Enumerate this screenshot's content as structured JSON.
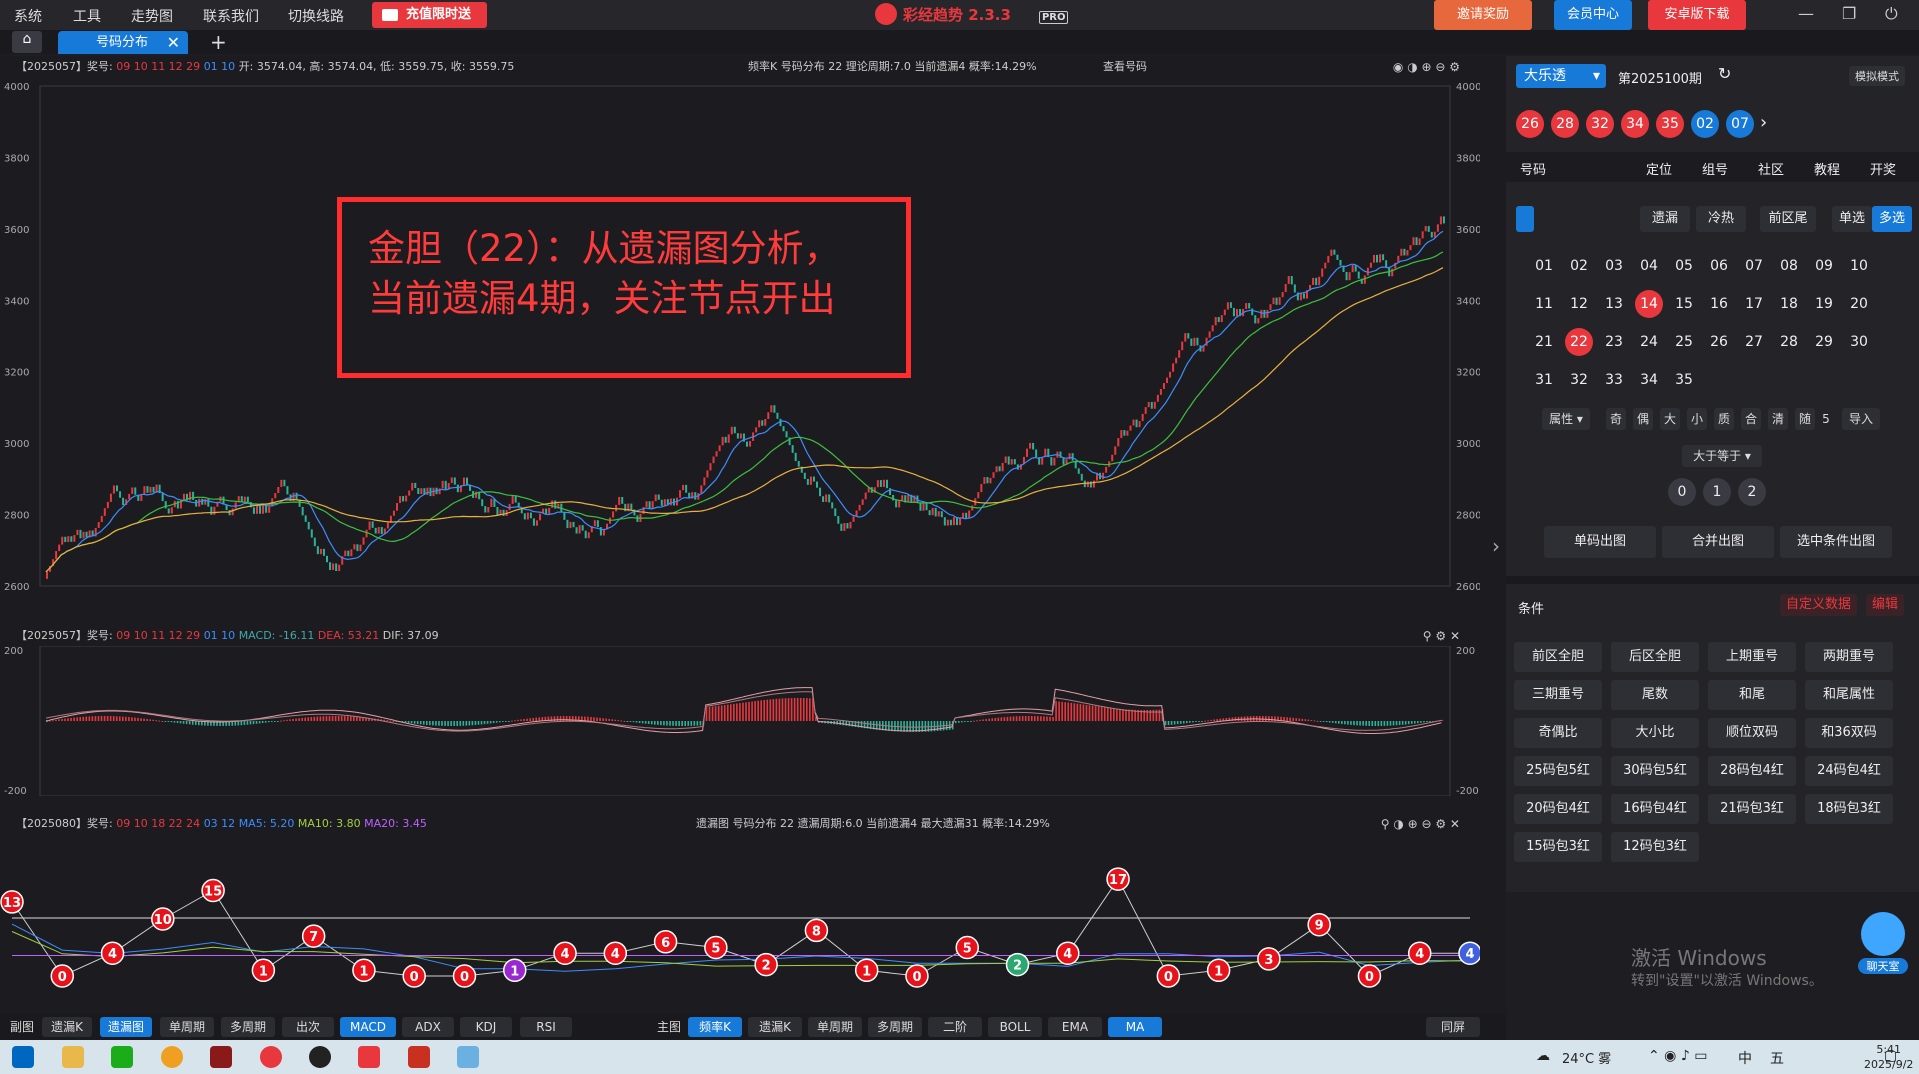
{
  "menu": [
    "系统",
    "工具",
    "走势图",
    "联系我们",
    "切换线路"
  ],
  "promo": "充值限时送",
  "app": {
    "title": "彩经趋势 2.3.3",
    "pro": "PRO"
  },
  "header": {
    "invite": "邀请奖励",
    "member": "会员中心",
    "android": "安卓版下载"
  },
  "tab": {
    "label": "号码分布",
    "add": "+"
  },
  "main_panel": {
    "period": "【2025057】奖号:",
    "nums_red": "09 10 11 12 29",
    "nums_blue": "01 10",
    "ohlc": "开: 3574.04, 高: 3574.04, 低: 3559.75, 收: 3559.75",
    "right_info": "频率K  号码分布  22    理论周期:7.0   当前遗漏4    概率:14.29%",
    "view": "查看号码"
  },
  "main_axis": [
    "4000",
    "3800",
    "3600",
    "3400",
    "3200",
    "3000",
    "2800",
    "2600"
  ],
  "annotation": {
    "line1": "金胆（22）：从遗漏图分析，",
    "line2": "当前遗漏4期，关注节点开出"
  },
  "macd_panel": {
    "period": "【2025057】奖号:",
    "nums_red": "09 10 11 12 29",
    "nums_blue": "01 10",
    "macd": "MACD: -16.11",
    "dea": "DEA: 53.21",
    "dif": "DIF: 37.09"
  },
  "macd_axis": [
    "200",
    "-200"
  ],
  "miss_panel": {
    "period": "【2025080】奖号:",
    "nums_red": "09 10 18 22 24",
    "nums_blue": "03 12",
    "ma5": "MA5: 5.20",
    "ma10": "MA10: 3.80",
    "ma20": "MA20: 3.45",
    "right_info": "遗漏图   号码分布  22    遗漏周期:6.0   当前遗漏4    最大遗漏31    概率:14.29%"
  },
  "miss_values": [
    13,
    0,
    4,
    10,
    15,
    1,
    7,
    1,
    0,
    0,
    1,
    4,
    4,
    6,
    5,
    2,
    8,
    1,
    0,
    5,
    2,
    4,
    17,
    0,
    1,
    3,
    9,
    0,
    4,
    4
  ],
  "miss_colors": [
    "r",
    "r",
    "r",
    "r",
    "r",
    "r",
    "r",
    "r",
    "r",
    "r",
    "p",
    "r",
    "r",
    "r",
    "r",
    "r",
    "r",
    "r",
    "r",
    "r",
    "g",
    "r",
    "r",
    "r",
    "r",
    "r",
    "r",
    "r",
    "r",
    "b"
  ],
  "bottombar": {
    "sub_label": "副图",
    "sub": [
      "遗漏K",
      "遗漏图",
      "单周期",
      "多周期",
      "出次",
      "MACD",
      "ADX",
      "KDJ",
      "RSI"
    ],
    "main_label": "主图",
    "main": [
      "频率K",
      "遗漏K",
      "单周期",
      "多周期",
      "二阶",
      "BOLL",
      "EMA",
      "MA"
    ],
    "sync": "同屏"
  },
  "right": {
    "lottery": "大乐透",
    "period": "第2025100期",
    "sim": "模拟模式",
    "balls_red": [
      "26",
      "28",
      "32",
      "34",
      "35"
    ],
    "balls_blue": [
      "02",
      "07"
    ],
    "tabs": [
      "号码",
      "定位",
      "组号",
      "社区",
      "教程",
      "开奖"
    ],
    "subtabs": [
      "遗漏",
      "冷热",
      "前区尾",
      "单选",
      "多选"
    ],
    "numbers": [
      "01",
      "02",
      "03",
      "04",
      "05",
      "06",
      "07",
      "08",
      "09",
      "10",
      "11",
      "12",
      "13",
      "14",
      "15",
      "16",
      "17",
      "18",
      "19",
      "20",
      "21",
      "22",
      "23",
      "24",
      "25",
      "26",
      "27",
      "28",
      "29",
      "30",
      "31",
      "32",
      "33",
      "34",
      "35"
    ],
    "selected": [
      "14",
      "22"
    ],
    "attrs": [
      "属性",
      "奇",
      "偶",
      "大",
      "小",
      "质",
      "合",
      "清",
      "随",
      "5",
      "导入"
    ],
    "compare": "大于等于",
    "counts": [
      "0",
      "1",
      "2"
    ],
    "actions": [
      "单码出图",
      "合并出图",
      "选中条件出图"
    ],
    "cond_title": "条件",
    "custom": "自定义数据",
    "edit": "编辑",
    "conditions": [
      "前区全胆",
      "后区全胆",
      "上期重号",
      "两期重号",
      "三期重号",
      "尾数",
      "和尾",
      "和尾属性",
      "奇偶比",
      "大小比",
      "顺位双码",
      "和36双码",
      "25码包5红",
      "30码包5红",
      "28码包4红",
      "24码包4红",
      "20码包4红",
      "16码包4红",
      "21码包3红",
      "18码包3红",
      "15码包3红",
      "12码包3红"
    ],
    "activate1": "激活 Windows",
    "activate2": "转到\"设置\"以激活 Windows。",
    "chat": "聊天室"
  },
  "taskbar": {
    "weather": "24°C 雾",
    "ime": "中",
    "ime2": "五",
    "time": "5:41",
    "date": "2025/9/2"
  }
}
